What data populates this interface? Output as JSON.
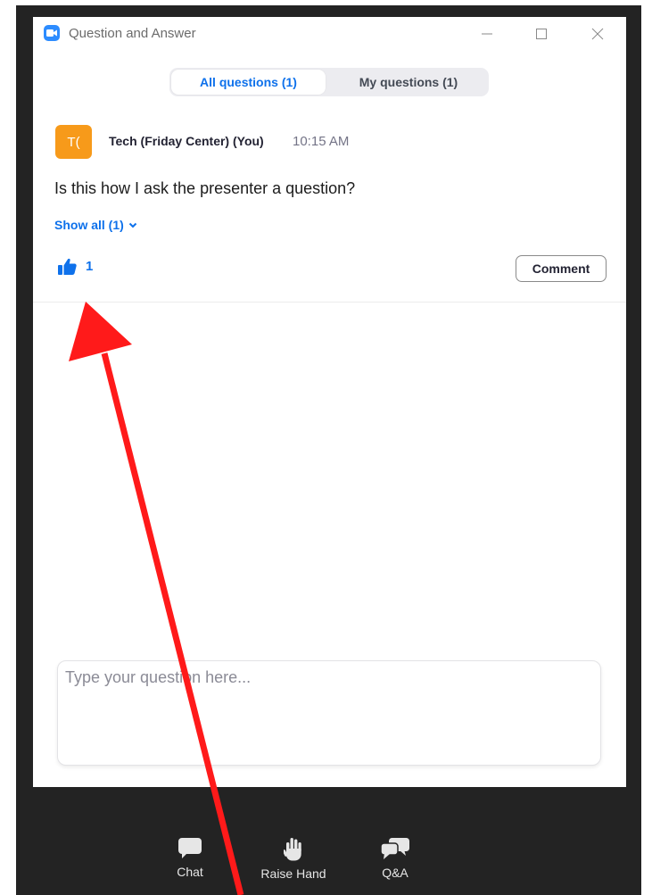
{
  "window": {
    "title": "Question and Answer",
    "icon": "zoom-camera-icon"
  },
  "tabs": [
    {
      "label": "All questions (1)",
      "active": true
    },
    {
      "label": "My questions (1)",
      "active": false
    }
  ],
  "question": {
    "avatar_initials": "T(",
    "avatar_color": "#f79a1a",
    "author": "Tech (Friday Center) (You)",
    "time": "10:15 AM",
    "text": "Is this how I ask the presenter a question?",
    "show_all_label": "Show all (1)",
    "upvotes": "1",
    "comment_label": "Comment"
  },
  "input": {
    "placeholder": "Type your question here..."
  },
  "toolbar": {
    "chat_label": "Chat",
    "raise_hand_label": "Raise Hand",
    "qa_label": "Q&A"
  },
  "colors": {
    "accent": "#0e71eb",
    "toolbar_bg": "#232323",
    "annotation_arrow": "#ff1a1a"
  }
}
